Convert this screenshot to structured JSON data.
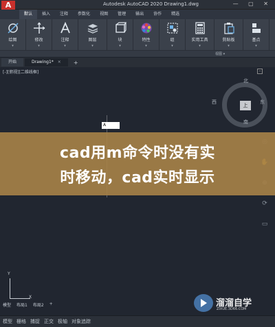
{
  "window": {
    "logo": "A",
    "title": "Autodesk AutoCAD 2020    Drawing1.dwg",
    "controls": "—  ▢  ✕"
  },
  "ribbon_tabs": [
    "默认",
    "插入",
    "注释",
    "参数化",
    "视图",
    "管理",
    "输出",
    "协作",
    "精选"
  ],
  "tools": [
    {
      "label": "绘图",
      "icon": "draw-icon"
    },
    {
      "label": "修改",
      "icon": "modify-icon"
    },
    {
      "label": "注释",
      "icon": "annotation-icon"
    },
    {
      "label": "图层",
      "icon": "layers-icon"
    },
    {
      "label": "块",
      "icon": "block-icon"
    },
    {
      "label": "特性",
      "icon": "properties-icon"
    },
    {
      "label": "组",
      "icon": "group-icon"
    },
    {
      "label": "实用工具",
      "icon": "utilities-icon"
    },
    {
      "label": "剪贴板",
      "icon": "clipboard-icon"
    },
    {
      "label": "基点",
      "icon": "base-icon"
    }
  ],
  "panel_footer": "视图 ▾",
  "file_tabs": [
    {
      "label": "开始"
    },
    {
      "label": "Drawing1*"
    }
  ],
  "viewport_label": "[-][俯视][二维线框]",
  "viewcube": {
    "face": "上",
    "north": "北",
    "south": "南",
    "east": "东",
    "west": "西"
  },
  "command_tip": "A",
  "ucs": {
    "x": "X",
    "y": "Y"
  },
  "banner": {
    "line1": "cad用m命令时没有实",
    "line2": "时移动，cad实时显示"
  },
  "watermark": {
    "text": "溜溜自学",
    "url": "ZIXUE.3D66.COM"
  },
  "model_tabs": [
    "模型",
    "布局1",
    "布局2",
    "+"
  ],
  "status_items": [
    "模型",
    "栅格",
    "捕捉",
    "正交",
    "极轴",
    "对象追踪"
  ]
}
